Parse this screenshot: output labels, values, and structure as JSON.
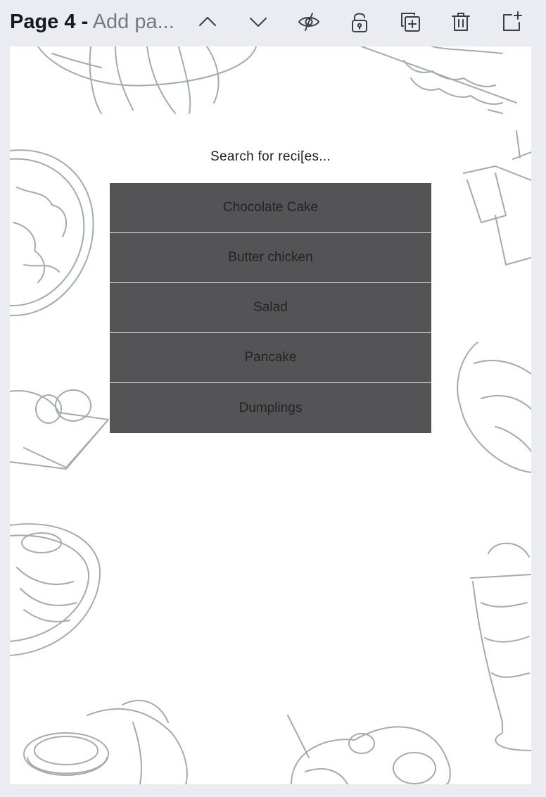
{
  "toolbar": {
    "page_label": "Page 4",
    "separator": "-",
    "title_placeholder": "Add pa...",
    "buttons": {
      "move_up": "chevron-up-icon",
      "move_down": "chevron-down-icon",
      "hide": "eye-slash-icon",
      "lock": "unlock-icon",
      "duplicate": "duplicate-icon",
      "delete": "trash-icon",
      "add_page": "add-page-icon"
    }
  },
  "canvas": {
    "search_label": "Search for reci[es...",
    "recipes": [
      "Chocolate Cake",
      "Butter chicken",
      "Salad",
      "Pancake",
      "Dumplings"
    ],
    "colors": {
      "list_bg": "#545456",
      "list_text": "#232323",
      "illustration": "#a3aca7",
      "page_bg": "#ffffff",
      "workspace_bg": "#ebecf1"
    }
  }
}
